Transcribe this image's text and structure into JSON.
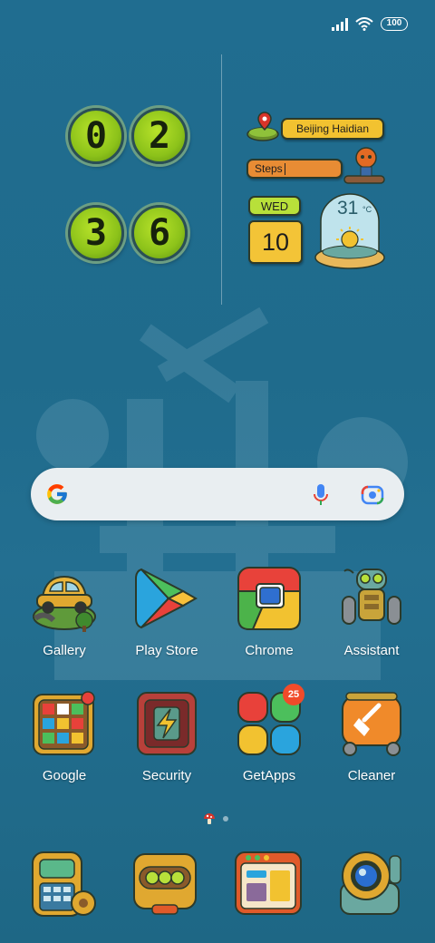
{
  "status_bar": {
    "battery": "100"
  },
  "clock": {
    "h1": "0",
    "h2": "2",
    "m1": "3",
    "m2": "6"
  },
  "info_widget": {
    "location": "Beijing Haidian",
    "steps_label": "Steps",
    "day": "WED",
    "date": "10",
    "temperature": "31",
    "temperature_unit": "°C"
  },
  "search": {
    "placeholder": ""
  },
  "apps_row1": [
    {
      "label": "Gallery",
      "icon": "car-on-hill-icon"
    },
    {
      "label": "Play Store",
      "icon": "play-triangle-icon"
    },
    {
      "label": "Chrome",
      "icon": "chrome-icon"
    },
    {
      "label": "Assistant",
      "icon": "robot-icon"
    }
  ],
  "apps_row2": [
    {
      "label": "Google",
      "icon": "google-apps-folder-icon"
    },
    {
      "label": "Security",
      "icon": "lightning-shield-icon"
    },
    {
      "label": "GetApps",
      "icon": "four-petal-icon",
      "badge": "25"
    },
    {
      "label": "Cleaner",
      "icon": "broom-icon"
    }
  ],
  "dock": [
    {
      "icon": "phone-icon"
    },
    {
      "icon": "messages-icon"
    },
    {
      "icon": "browser-icon"
    },
    {
      "icon": "camera-icon"
    }
  ],
  "colors": {
    "background": "#206d90",
    "clock_digit": "#9fd21f",
    "location_pill": "#f2c230",
    "steps_pill": "#e88c34",
    "badge": "#f04b2a"
  }
}
